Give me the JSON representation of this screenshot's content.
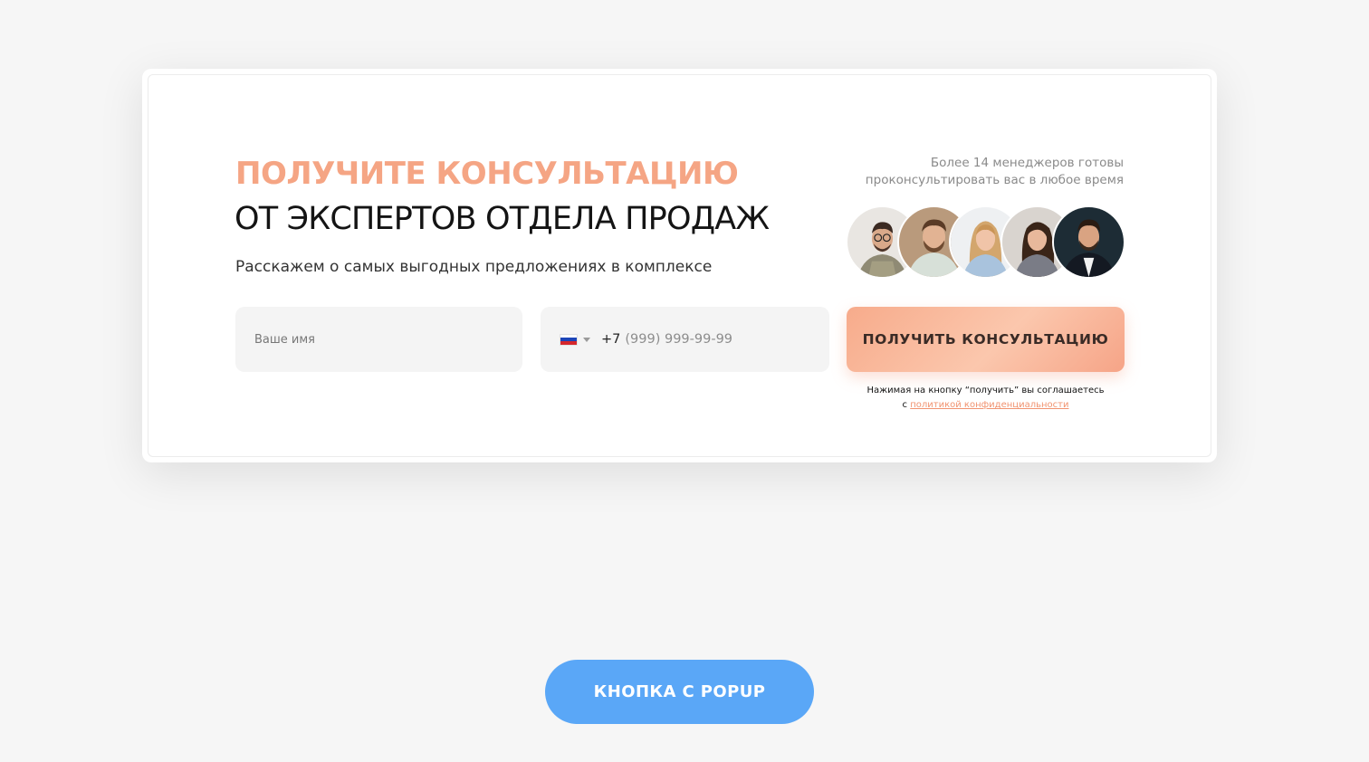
{
  "form": {
    "title_accent": "ПОЛУЧИТЕ КОНСУЛЬТАЦИЮ",
    "title_main": "ОТ ЭКСПЕРТОВ ОТДЕЛА ПРОДАЖ",
    "subtitle": "Расскажем о самых выгодных предложениях в комплексе",
    "managers_note_line1": "Более 14 менеджеров готовы",
    "managers_note_line2": "проконсультировать вас в любое время",
    "name_placeholder": "Ваше имя",
    "phone_country_icon": "russia-flag-icon",
    "phone_prefix": "+7",
    "phone_mask": "(999) 999-99-99",
    "submit_label": "ПОЛУЧИТЬ КОНСУЛЬТАЦИЮ",
    "legal_text": "Нажимая на кнопку “получить” вы соглашаетесь",
    "legal_prefix": "с",
    "legal_link": "политикой конфиденциальности"
  },
  "popup_button_label": "КНОПКА С POPUP",
  "colors": {
    "accent": "#f5a584",
    "button_gradient_start": "#f7ab8b",
    "popup_button": "#5aa7f7",
    "link": "#f19370",
    "background": "#f6f6f6"
  }
}
